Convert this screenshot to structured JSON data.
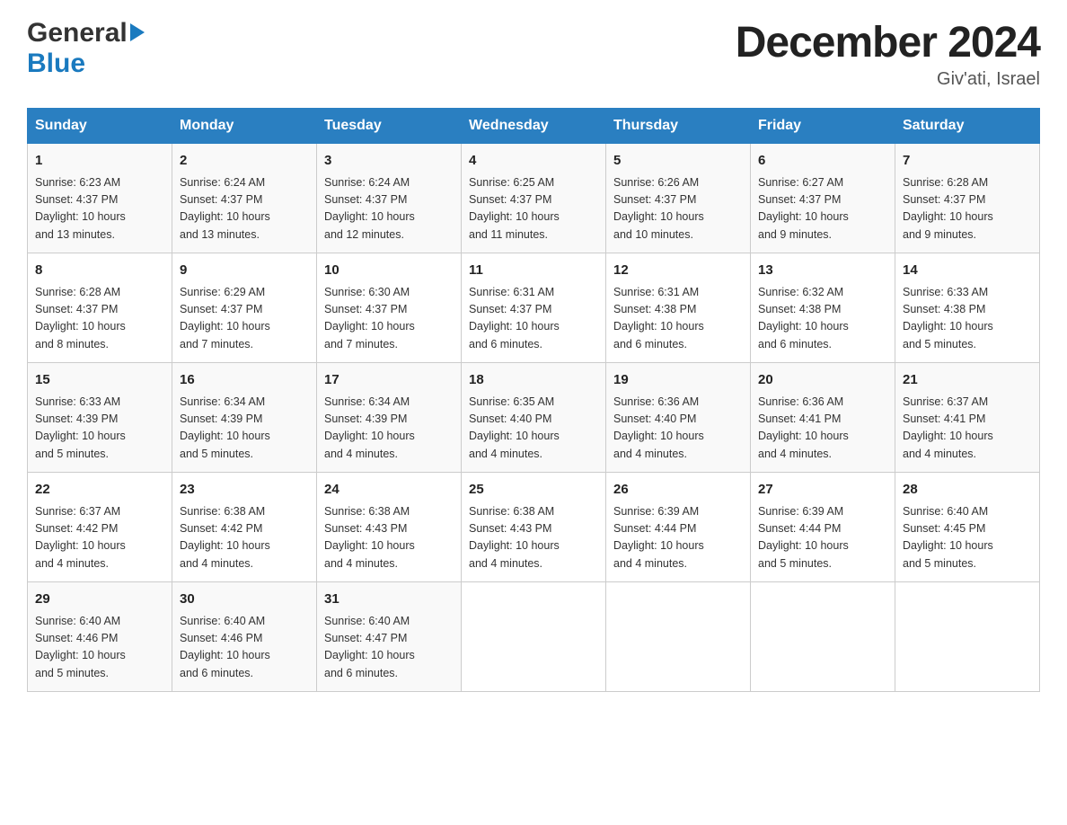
{
  "header": {
    "logo_general": "General",
    "logo_blue": "Blue",
    "title": "December 2024",
    "subtitle": "Giv'ati, Israel"
  },
  "weekdays": [
    "Sunday",
    "Monday",
    "Tuesday",
    "Wednesday",
    "Thursday",
    "Friday",
    "Saturday"
  ],
  "weeks": [
    [
      {
        "day": "1",
        "sunrise": "6:23 AM",
        "sunset": "4:37 PM",
        "daylight": "10 hours and 13 minutes."
      },
      {
        "day": "2",
        "sunrise": "6:24 AM",
        "sunset": "4:37 PM",
        "daylight": "10 hours and 13 minutes."
      },
      {
        "day": "3",
        "sunrise": "6:24 AM",
        "sunset": "4:37 PM",
        "daylight": "10 hours and 12 minutes."
      },
      {
        "day": "4",
        "sunrise": "6:25 AM",
        "sunset": "4:37 PM",
        "daylight": "10 hours and 11 minutes."
      },
      {
        "day": "5",
        "sunrise": "6:26 AM",
        "sunset": "4:37 PM",
        "daylight": "10 hours and 10 minutes."
      },
      {
        "day": "6",
        "sunrise": "6:27 AM",
        "sunset": "4:37 PM",
        "daylight": "10 hours and 9 minutes."
      },
      {
        "day": "7",
        "sunrise": "6:28 AM",
        "sunset": "4:37 PM",
        "daylight": "10 hours and 9 minutes."
      }
    ],
    [
      {
        "day": "8",
        "sunrise": "6:28 AM",
        "sunset": "4:37 PM",
        "daylight": "10 hours and 8 minutes."
      },
      {
        "day": "9",
        "sunrise": "6:29 AM",
        "sunset": "4:37 PM",
        "daylight": "10 hours and 7 minutes."
      },
      {
        "day": "10",
        "sunrise": "6:30 AM",
        "sunset": "4:37 PM",
        "daylight": "10 hours and 7 minutes."
      },
      {
        "day": "11",
        "sunrise": "6:31 AM",
        "sunset": "4:37 PM",
        "daylight": "10 hours and 6 minutes."
      },
      {
        "day": "12",
        "sunrise": "6:31 AM",
        "sunset": "4:38 PM",
        "daylight": "10 hours and 6 minutes."
      },
      {
        "day": "13",
        "sunrise": "6:32 AM",
        "sunset": "4:38 PM",
        "daylight": "10 hours and 6 minutes."
      },
      {
        "day": "14",
        "sunrise": "6:33 AM",
        "sunset": "4:38 PM",
        "daylight": "10 hours and 5 minutes."
      }
    ],
    [
      {
        "day": "15",
        "sunrise": "6:33 AM",
        "sunset": "4:39 PM",
        "daylight": "10 hours and 5 minutes."
      },
      {
        "day": "16",
        "sunrise": "6:34 AM",
        "sunset": "4:39 PM",
        "daylight": "10 hours and 5 minutes."
      },
      {
        "day": "17",
        "sunrise": "6:34 AM",
        "sunset": "4:39 PM",
        "daylight": "10 hours and 4 minutes."
      },
      {
        "day": "18",
        "sunrise": "6:35 AM",
        "sunset": "4:40 PM",
        "daylight": "10 hours and 4 minutes."
      },
      {
        "day": "19",
        "sunrise": "6:36 AM",
        "sunset": "4:40 PM",
        "daylight": "10 hours and 4 minutes."
      },
      {
        "day": "20",
        "sunrise": "6:36 AM",
        "sunset": "4:41 PM",
        "daylight": "10 hours and 4 minutes."
      },
      {
        "day": "21",
        "sunrise": "6:37 AM",
        "sunset": "4:41 PM",
        "daylight": "10 hours and 4 minutes."
      }
    ],
    [
      {
        "day": "22",
        "sunrise": "6:37 AM",
        "sunset": "4:42 PM",
        "daylight": "10 hours and 4 minutes."
      },
      {
        "day": "23",
        "sunrise": "6:38 AM",
        "sunset": "4:42 PM",
        "daylight": "10 hours and 4 minutes."
      },
      {
        "day": "24",
        "sunrise": "6:38 AM",
        "sunset": "4:43 PM",
        "daylight": "10 hours and 4 minutes."
      },
      {
        "day": "25",
        "sunrise": "6:38 AM",
        "sunset": "4:43 PM",
        "daylight": "10 hours and 4 minutes."
      },
      {
        "day": "26",
        "sunrise": "6:39 AM",
        "sunset": "4:44 PM",
        "daylight": "10 hours and 4 minutes."
      },
      {
        "day": "27",
        "sunrise": "6:39 AM",
        "sunset": "4:44 PM",
        "daylight": "10 hours and 5 minutes."
      },
      {
        "day": "28",
        "sunrise": "6:40 AM",
        "sunset": "4:45 PM",
        "daylight": "10 hours and 5 minutes."
      }
    ],
    [
      {
        "day": "29",
        "sunrise": "6:40 AM",
        "sunset": "4:46 PM",
        "daylight": "10 hours and 5 minutes."
      },
      {
        "day": "30",
        "sunrise": "6:40 AM",
        "sunset": "4:46 PM",
        "daylight": "10 hours and 6 minutes."
      },
      {
        "day": "31",
        "sunrise": "6:40 AM",
        "sunset": "4:47 PM",
        "daylight": "10 hours and 6 minutes."
      },
      null,
      null,
      null,
      null
    ]
  ],
  "labels": {
    "sunrise": "Sunrise:",
    "sunset": "Sunset:",
    "daylight": "Daylight:"
  }
}
